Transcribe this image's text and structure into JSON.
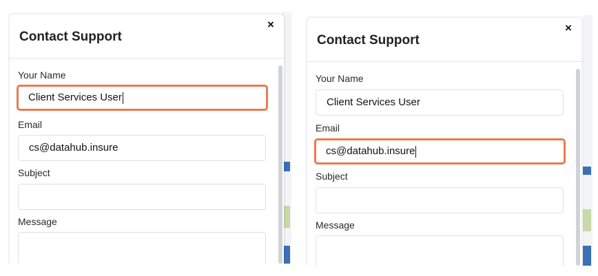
{
  "panels": [
    {
      "modal_title": "Contact Support",
      "close_glyph": "×",
      "fields": {
        "name": {
          "label": "Your Name",
          "value": "Client Services User",
          "placeholder": ""
        },
        "email": {
          "label": "Email",
          "value": "cs@datahub.insure",
          "placeholder": ""
        },
        "subject": {
          "label": "Subject",
          "value": "",
          "placeholder": ""
        },
        "message": {
          "label": "Message",
          "value": "",
          "placeholder": ""
        }
      },
      "focused_field": "name"
    },
    {
      "modal_title": "Contact Support",
      "close_glyph": "×",
      "fields": {
        "name": {
          "label": "Your Name",
          "value": "Client Services User",
          "placeholder": ""
        },
        "email": {
          "label": "Email",
          "value": "cs@datahub.insure",
          "placeholder": ""
        },
        "subject": {
          "label": "Subject",
          "value": "",
          "placeholder": ""
        },
        "message": {
          "label": "Message",
          "value": "",
          "placeholder": ""
        }
      },
      "focused_field": "email"
    }
  ],
  "colors": {
    "focus_ring": "#ea7a4f",
    "field_border": "#dcdfe4",
    "backdrop_blue": "#3b6fb6",
    "backdrop_green": "#c7d9a8"
  }
}
